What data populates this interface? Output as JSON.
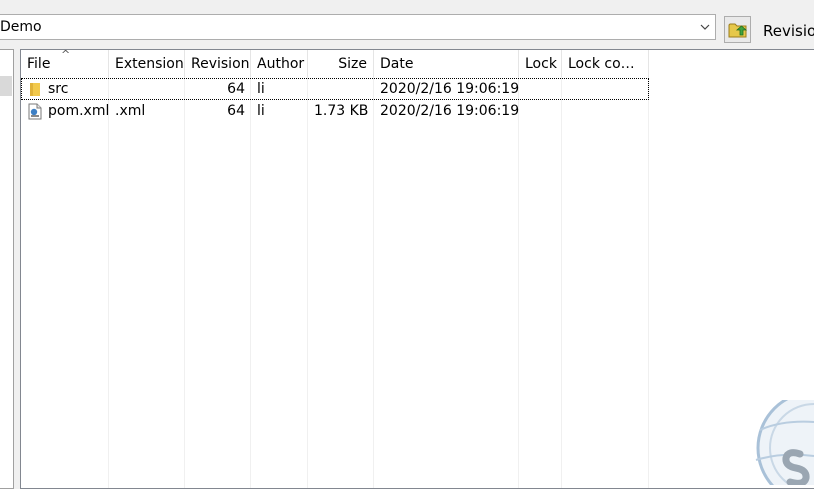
{
  "location": {
    "path_text": "Demo"
  },
  "toolbar": {
    "revision_label": "Revisio"
  },
  "columns": [
    {
      "key": "file",
      "label": "File"
    },
    {
      "key": "extension",
      "label": "Extension"
    },
    {
      "key": "revision",
      "label": "Revision"
    },
    {
      "key": "author",
      "label": "Author"
    },
    {
      "key": "size",
      "label": "Size"
    },
    {
      "key": "date",
      "label": "Date"
    },
    {
      "key": "lock",
      "label": "Lock"
    },
    {
      "key": "lock_comment",
      "label": "Lock co…"
    }
  ],
  "rows": [
    {
      "icon": "folder-icon",
      "file": "src",
      "extension": "",
      "revision": "64",
      "author": "li",
      "size": "",
      "date": "2020/2/16 19:06:19",
      "lock": "",
      "lock_comment": ""
    },
    {
      "icon": "xml-file-icon",
      "file": "pom.xml",
      "extension": ".xml",
      "revision": "64",
      "author": "li",
      "size": "1.73 KB",
      "date": "2020/2/16 19:06:19",
      "lock": "",
      "lock_comment": ""
    }
  ],
  "colors": {
    "folder": "#f2c94c",
    "watermark": "#a9c1d8"
  }
}
